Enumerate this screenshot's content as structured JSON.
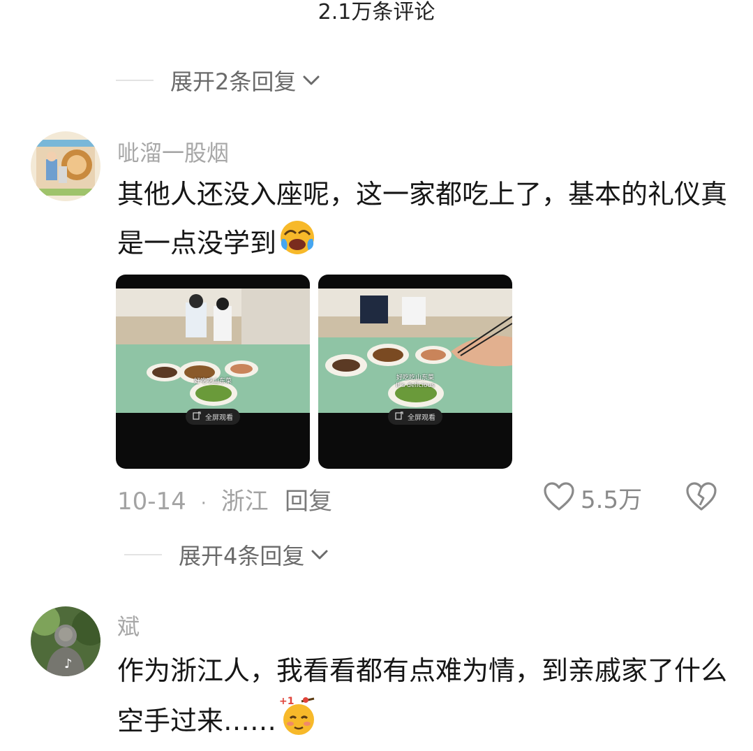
{
  "header": {
    "title": "2.1万条评论"
  },
  "expand_top": {
    "label": "展开2条回复"
  },
  "comments": [
    {
      "username": "呲溜一股烟",
      "text": "其他人还没入座呢，这一家都吃上了，基本的礼仪真是一点没学到",
      "emoji": "laughing-crying-face-icon",
      "images": [
        {
          "fullscreen_label": "全屏观看",
          "subtitle": "好吃吃山东菜"
        },
        {
          "fullscreen_label": "全屏观看",
          "subtitle": "好吃吃山东菜",
          "subtitle2": "It's delicious"
        }
      ],
      "date": "10-14",
      "separator": "·",
      "location": "浙江",
      "reply_label": "回复",
      "likes": "5.5万",
      "expand_label": "展开4条回复"
    },
    {
      "username": "斌",
      "text": "作为浙江人，我看看都有点难为情，到亲戚家了什么空手过来……",
      "emoji": "plus-one-shy-face-icon"
    }
  ],
  "colors": {
    "text": "#161616",
    "muted": "#a3a3a3",
    "line": "#e3e3e3"
  }
}
